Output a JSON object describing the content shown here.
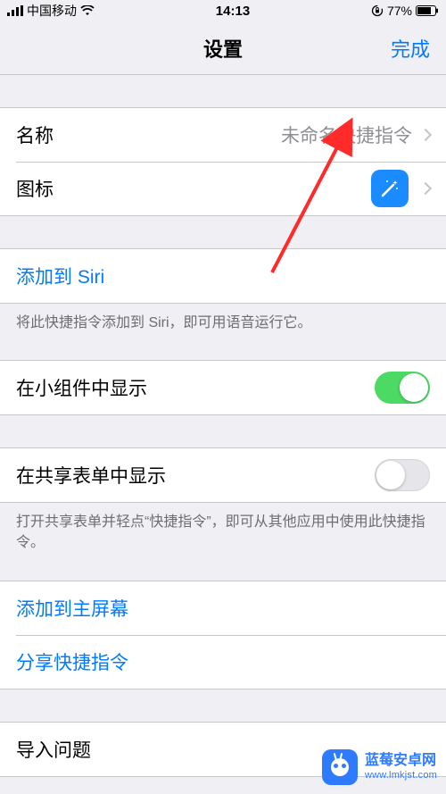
{
  "status": {
    "carrier": "中国移动",
    "time": "14:13",
    "battery": "77%"
  },
  "nav": {
    "title": "设置",
    "done": "完成"
  },
  "rows": {
    "name_label": "名称",
    "name_value": "未命名快捷指令",
    "icon_label": "图标",
    "add_to_siri": "添加到 Siri",
    "add_to_siri_footer": "将此快捷指令添加到 Siri，即可用语音运行它。",
    "show_in_widget": "在小组件中显示",
    "show_in_share_sheet": "在共享表单中显示",
    "share_sheet_footer": "打开共享表单并轻点“快捷指令”，即可从其他应用中使用此快捷指令。",
    "add_to_home": "添加到主屏幕",
    "share_shortcut": "分享快捷指令",
    "import_questions": "导入问题"
  },
  "switches": {
    "show_in_widget": true,
    "show_in_share_sheet": false
  },
  "icons": {
    "shortcut_icon": "wand-icon",
    "chevron": "chevron-right-icon",
    "signal": "signal-icon",
    "wifi": "wifi-icon",
    "lock": "lock-rotation-icon",
    "battery": "battery-icon"
  },
  "watermark": {
    "name": "蓝莓安卓网",
    "url": "www.lmkjst.com"
  }
}
